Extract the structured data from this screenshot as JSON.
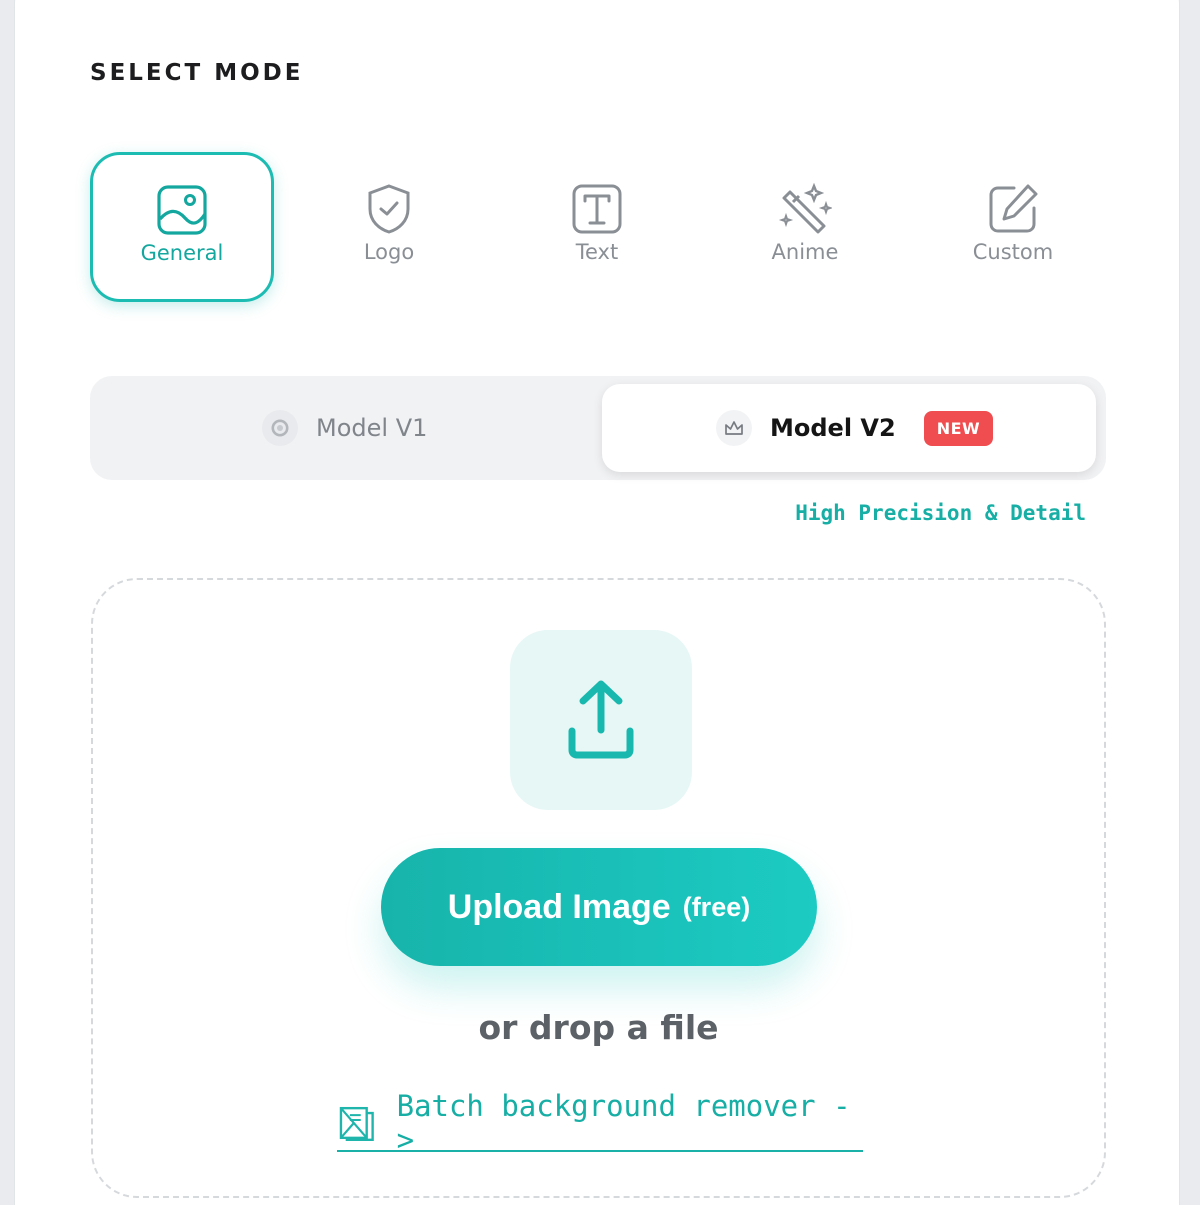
{
  "section_title": "SELECT MODE",
  "colors": {
    "accent": "#1cbcb3",
    "accent_text": "#16aea5",
    "badge": "#ef4d4f",
    "muted": "#8a8f96"
  },
  "modes": [
    {
      "label": "General",
      "icon": "image-icon",
      "active": true
    },
    {
      "label": "Logo",
      "icon": "shield-check-icon",
      "active": false
    },
    {
      "label": "Text",
      "icon": "text-box-icon",
      "active": false
    },
    {
      "label": "Anime",
      "icon": "magic-wand-icon",
      "active": false
    },
    {
      "label": "Custom",
      "icon": "edit-pen-icon",
      "active": false
    }
  ],
  "models": {
    "v1": {
      "label": "Model V1",
      "icon": "gear-icon",
      "selected": false
    },
    "v2": {
      "label": "Model V2",
      "icon": "crown-icon",
      "badge": "NEW",
      "selected": true
    },
    "caption": "High Precision & Detail"
  },
  "upload": {
    "icon": "upload-icon",
    "button_label": "Upload Image",
    "button_suffix": "(free)",
    "drop_text": "or drop a file",
    "batch_link": "Batch background remover ->",
    "batch_icon": "batch-images-icon"
  }
}
